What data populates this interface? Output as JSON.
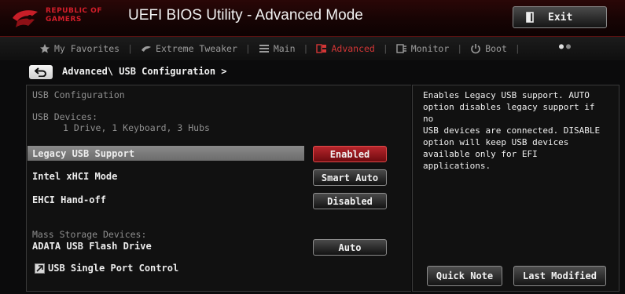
{
  "header": {
    "brand_line1": "REPUBLIC OF",
    "brand_line2": "GAMERS",
    "title": "UEFI BIOS Utility - Advanced Mode",
    "exit_label": "Exit"
  },
  "tabs": [
    {
      "label": "My Favorites",
      "icon": "star-icon",
      "active": false
    },
    {
      "label": "Extreme Tweaker",
      "icon": "tweaker-icon",
      "active": false
    },
    {
      "label": "Main",
      "icon": "list-icon",
      "active": false
    },
    {
      "label": "Advanced",
      "icon": "advanced-icon",
      "active": true
    },
    {
      "label": "Monitor",
      "icon": "monitor-icon",
      "active": false
    },
    {
      "label": "Boot",
      "icon": "power-icon",
      "active": false
    }
  ],
  "breadcrumb": "Advanced\\ USB Configuration >",
  "main": {
    "section_title": "USB Configuration",
    "usb_devices_label": "USB Devices:",
    "usb_devices_value": "1 Drive, 1 Keyboard, 3 Hubs",
    "settings": [
      {
        "label": "Legacy USB Support",
        "value": "Enabled",
        "selected": true
      },
      {
        "label": "Intel xHCI Mode",
        "value": "Smart Auto",
        "selected": false
      },
      {
        "label": "EHCI Hand-off",
        "value": "Disabled",
        "selected": false
      }
    ],
    "mass_storage_label": "Mass Storage Devices:",
    "mass_storage_device": "ADATA USB Flash Drive",
    "mass_storage_value": "Auto",
    "submenu_label": "USB Single Port Control"
  },
  "help": {
    "text": "Enables Legacy USB support. AUTO\noption disables legacy support if no\nUSB devices are connected. DISABLE\noption will keep USB devices\navailable only for EFI applications."
  },
  "buttons": {
    "quick_note": "Quick Note",
    "last_modified": "Last Modified"
  },
  "colors": {
    "accent": "#d33636",
    "selected_value": "#a11c22"
  }
}
